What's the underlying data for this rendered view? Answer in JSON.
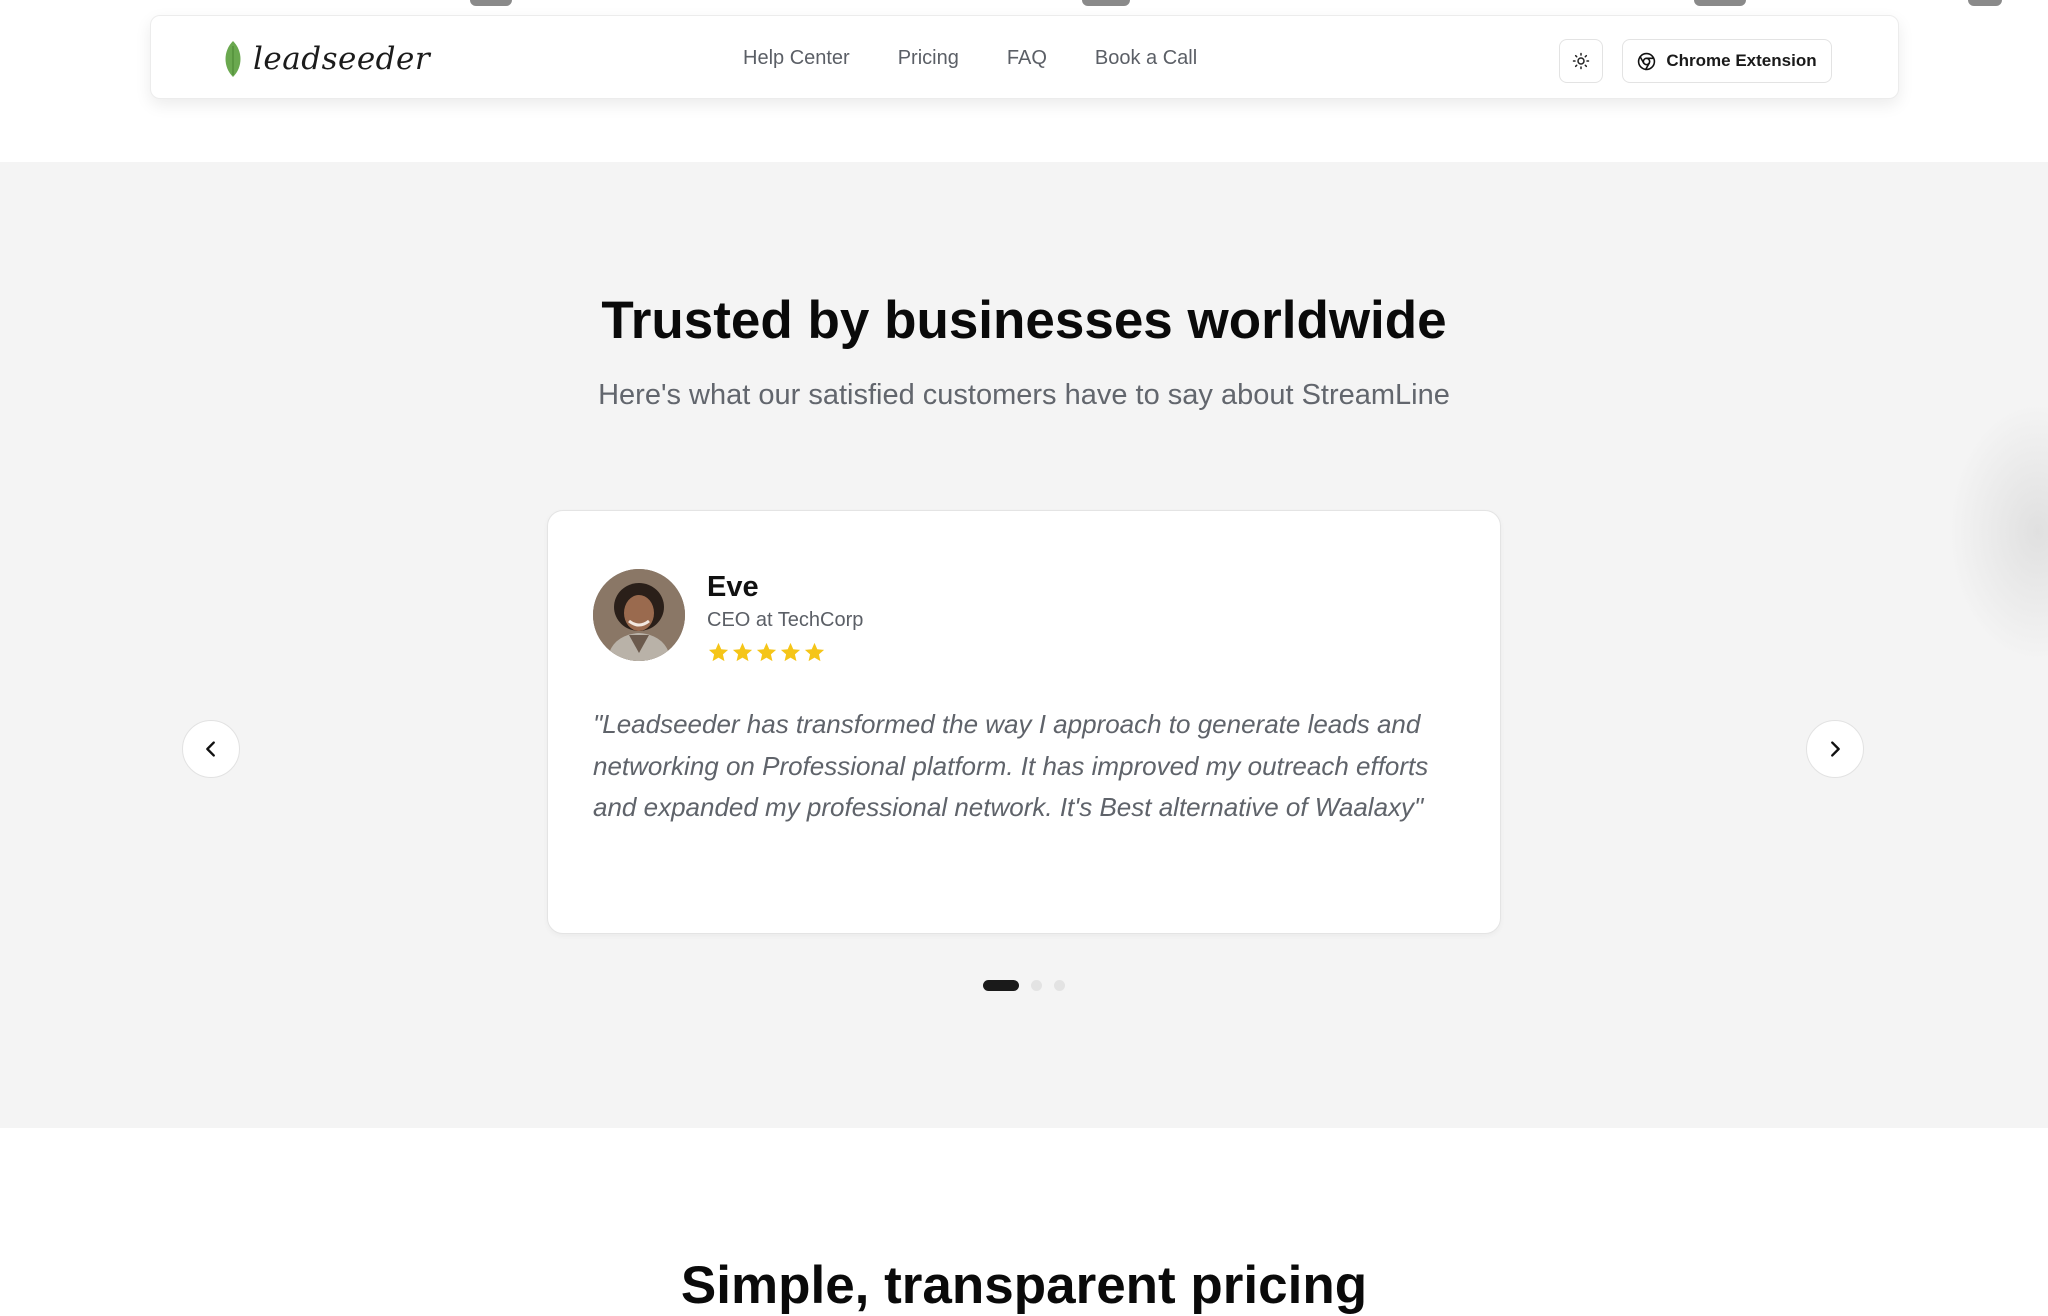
{
  "header": {
    "logo_text": "leadseeder",
    "nav": [
      {
        "label": "Help Center"
      },
      {
        "label": "Pricing"
      },
      {
        "label": "FAQ"
      },
      {
        "label": "Book a Call"
      }
    ],
    "theme_toggle_icon": "sun-icon",
    "extension_button_label": "Chrome Extension",
    "extension_button_icon": "chrome-icon"
  },
  "testimonials": {
    "title": "Trusted by businesses worldwide",
    "subtitle": "Here's what our satisfied customers have to say about StreamLine",
    "active_slide": {
      "name": "Eve",
      "role": "CEO at TechCorp",
      "rating": 5,
      "quote": "\"Leadseeder has transformed the way I approach to generate leads and networking on Professional platform. It has improved my outreach efforts and expanded my professional network. It's Best alternative of Waalaxy\""
    },
    "slide_count": 3,
    "current_index": 0
  },
  "next_section": {
    "title": "Simple, transparent pricing"
  },
  "colors": {
    "section_bg": "#f4f4f4",
    "star": "#f5c518",
    "leaf": "#6aa84f",
    "active_dot": "#1a1a1a"
  }
}
